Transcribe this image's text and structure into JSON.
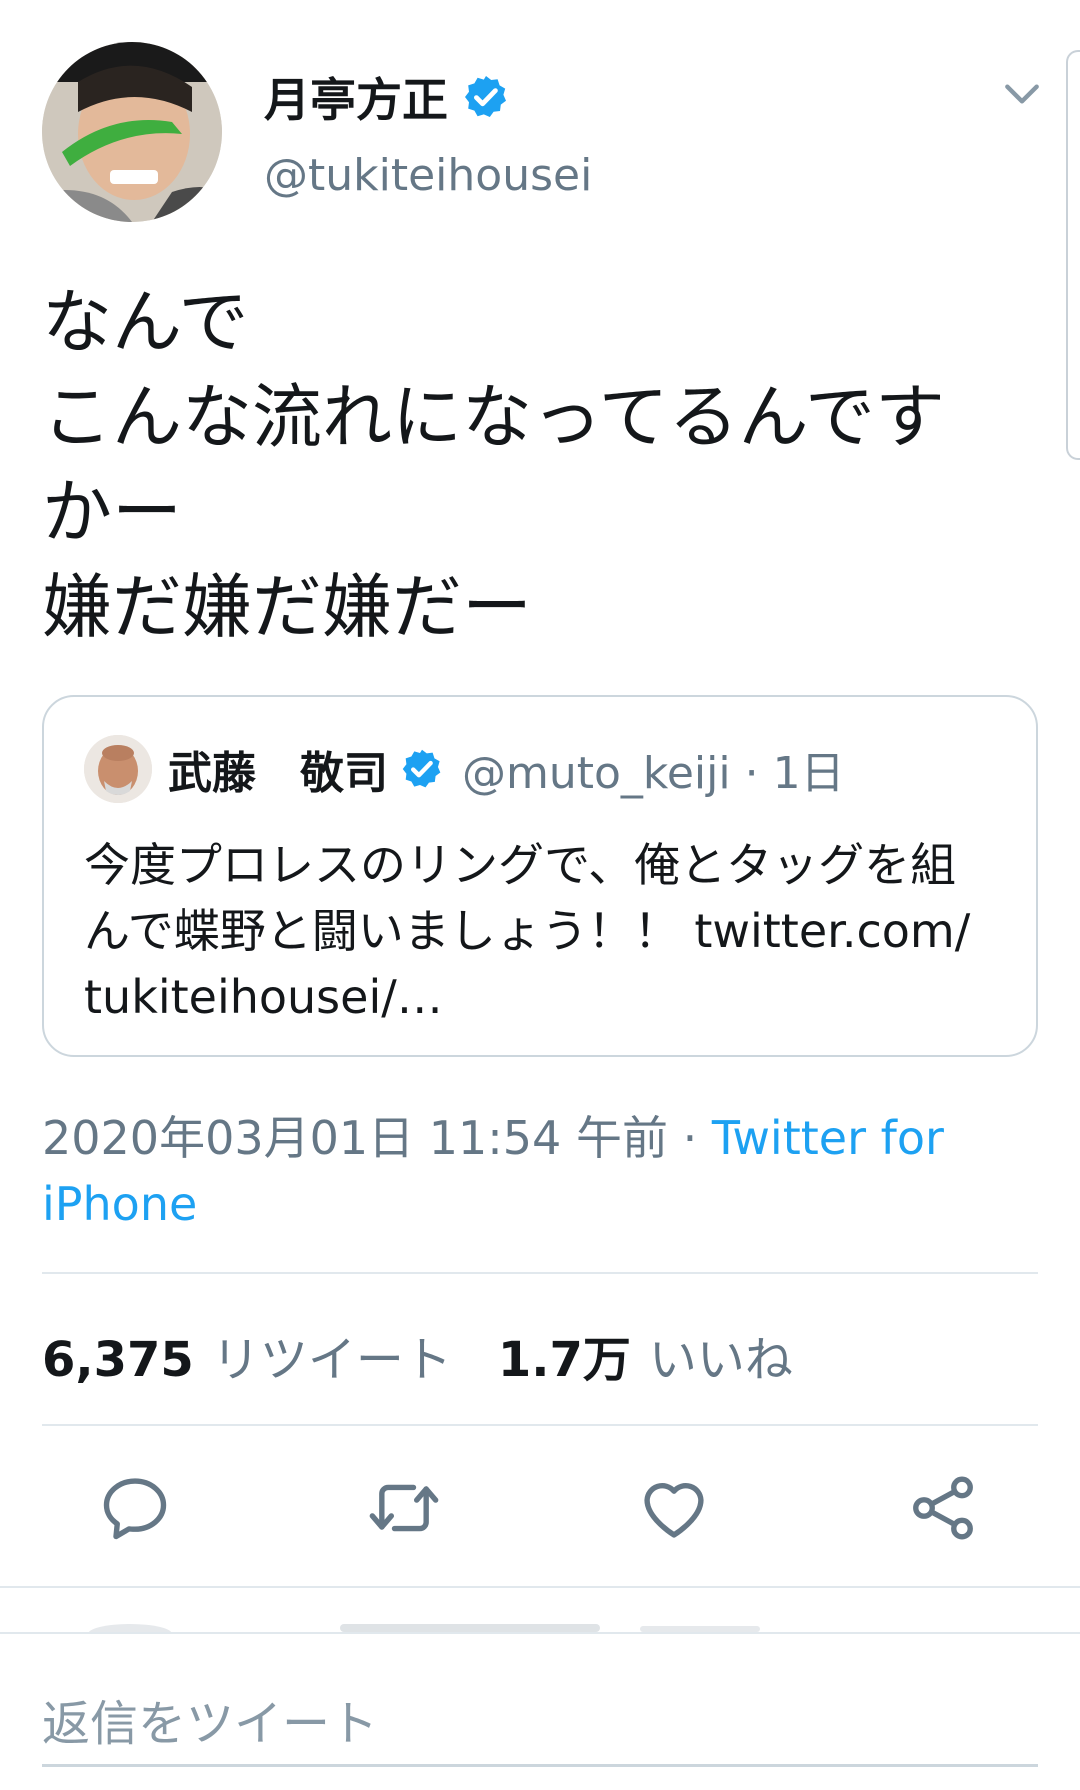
{
  "tweet": {
    "author": {
      "display_name": "月亭方正",
      "handle": "@tukiteihousei",
      "verified": true,
      "avatar_icon": "user-avatar"
    },
    "text_lines": [
      "なんで",
      "こんな流れになってるんです",
      "かー",
      "嫌だ嫌だ嫌だー"
    ],
    "more_menu_icon": "chevron-down-icon"
  },
  "quoted_tweet": {
    "author": {
      "display_name": "武藤　敬司",
      "handle": "@muto_keiji",
      "time": "1日",
      "verified": true
    },
    "text_lines": [
      "今度プロレスのリングで、俺とタッグを組",
      "んで蝶野と闘いましょう！！ twitter.com/",
      "tukiteihousei/…"
    ]
  },
  "meta": {
    "timestamp": "2020年03月01日 11:54 午前",
    "separator": "·",
    "source_line1": "Twitter for",
    "source_line2": "iPhone"
  },
  "stats": {
    "retweets_count": "6,375",
    "retweets_label": "リツイート",
    "likes_count": "1.7万",
    "likes_label": "いいね"
  },
  "actions": [
    {
      "name": "reply",
      "icon": "comment-icon"
    },
    {
      "name": "retweet",
      "icon": "retweet-icon"
    },
    {
      "name": "like",
      "icon": "heart-icon"
    },
    {
      "name": "share",
      "icon": "share-icon"
    }
  ],
  "reply_bar": {
    "placeholder": "返信をツイート"
  },
  "colors": {
    "accent": "#1da1f2",
    "text": "#14171a",
    "secondary": "#657786",
    "divider": "#e1e8ed"
  }
}
